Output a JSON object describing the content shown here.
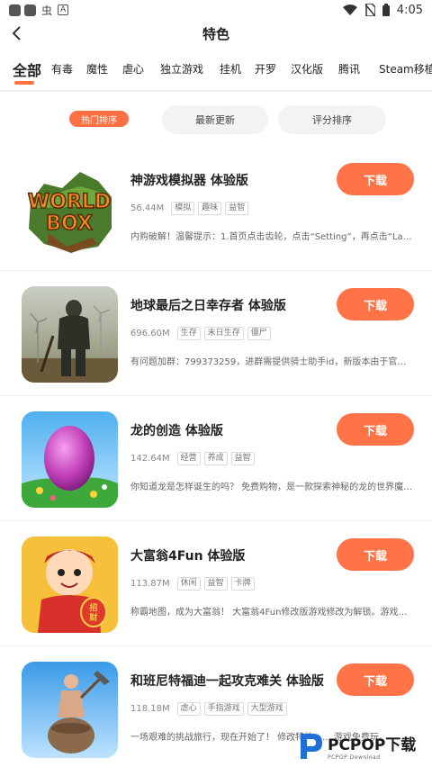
{
  "status_bar": {
    "left_glyphs": [
      "虫",
      "A"
    ],
    "time": "4:05"
  },
  "header": {
    "title": "特色"
  },
  "categories": [
    "全部",
    "有毒",
    "魔性",
    "虐心",
    "独立游戏",
    "挂机",
    "开罗",
    "汉化版",
    "腾讯",
    "Steam移植"
  ],
  "active_category_index": 0,
  "sort_tabs": [
    "热门排序",
    "最新更新",
    "评分排序"
  ],
  "active_sort_index": 0,
  "colors": {
    "accent": "#ff7043",
    "download_button": "#ff7346"
  },
  "download_label": "下载",
  "games": [
    {
      "name": "神游戏模拟器 体验版",
      "size": "56.44M",
      "tags": [
        "模拟",
        "趣味",
        "益智"
      ],
      "description": "内购破解！温馨提示：1.首页点击齿轮，点击“Setting”，再点击“Languag...",
      "icon": "worldbox-icon",
      "icon_text": [
        "WORLD",
        "BOX"
      ]
    },
    {
      "name": "地球最后之日幸存者 体验版",
      "size": "696.60M",
      "tags": [
        "生存",
        "末日生存",
        "僵尸"
      ],
      "description": "有问题加群：799373259，进群需提供骑士助手id，新版本由于官方问题...",
      "icon": "survivor-icon"
    },
    {
      "name": "龙的创造 体验版",
      "size": "142.64M",
      "tags": [
        "经营",
        "养成",
        "益智"
      ],
      "description": "你知道龙是怎样诞生的吗？ 免费购物，是一款探索神秘的龙的世界魔法世...",
      "icon": "dragon-egg-icon"
    },
    {
      "name": "大富翁4Fun 体验版",
      "size": "113.87M",
      "tags": [
        "休闲",
        "益智",
        "卡牌"
      ],
      "description": "称霸地图，成为大富翁！ 大富翁4Fun修改版游戏修改为解锁。游戏中大...",
      "icon": "monopoly-icon",
      "icon_text": [
        "招",
        "财"
      ]
    },
    {
      "name": "和班尼特福迪一起攻克难关 体验版",
      "size": "118.18M",
      "tags": [
        "虐心",
        "手指游戏",
        "大型游戏"
      ],
      "description": "一场艰难的挑战旅行，现在开始了！ 修改特性：... 游戏免费玩。",
      "icon": "getting-over-it-icon"
    }
  ],
  "watermark": {
    "main": "PCPOP下载",
    "sub": "PCPOP Download"
  }
}
